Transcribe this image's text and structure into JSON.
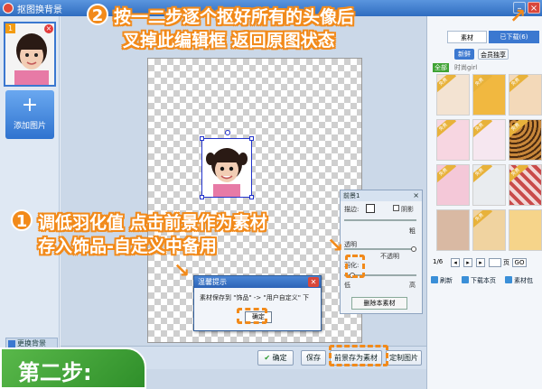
{
  "window": {
    "title": "抠图换背景",
    "minimize": "–",
    "close": "×"
  },
  "left_panel": {
    "thumb_badge": "1",
    "thumb_close": "×",
    "add_image_plus": "+",
    "add_image_label": "添加图片",
    "swap_background_label": "更换背景"
  },
  "right_panel": {
    "tab_material": "素材",
    "tab_downloaded": "已下载(6)",
    "sub_new": "新鲜",
    "sub_vip": "会员独享",
    "category_all": "全部",
    "category_name": "时尚girl",
    "free_badge": "免费",
    "pager": {
      "text": "1/6",
      "page_suffix": "页",
      "go": "GO"
    },
    "actions": {
      "refresh": "刷新",
      "download_page": "下载本页",
      "material_pack": "素材包"
    }
  },
  "foreground_panel": {
    "title": "前景1",
    "stroke_label": "描边:",
    "shadow_label": "阴影",
    "thick_label": "粗",
    "opacity_label": "透明",
    "opaque_label": "不透明",
    "feather_label": "羽化:",
    "low_label": "低",
    "high_label": "高",
    "delete_button": "删除本素材",
    "feather_level": 0.08
  },
  "dialog": {
    "title": "温馨提示",
    "message": "素材保存到 \"饰品\" -> \"用户自定义\" 下",
    "ok": "确定"
  },
  "bottom_bar": {
    "ok": "确定",
    "save": "保存",
    "save_fg_as_material": "前景存为素材",
    "custom_image": "定制图片"
  },
  "annotations": {
    "step1_num": "1",
    "step1_line1": "调低羽化值 点击前景作为素材",
    "step1_line2": "存入饰品-自定义中备用",
    "step2_num": "2",
    "step2_line1": "按一二步逐个抠好所有的头像后",
    "step2_line2": "叉掉此编辑框 返回原图状态",
    "step_label": "第二步:"
  },
  "colors": {
    "accent": "#f28a1a",
    "titlebar": "#2f6dc0",
    "step_green": "#3fa334"
  }
}
